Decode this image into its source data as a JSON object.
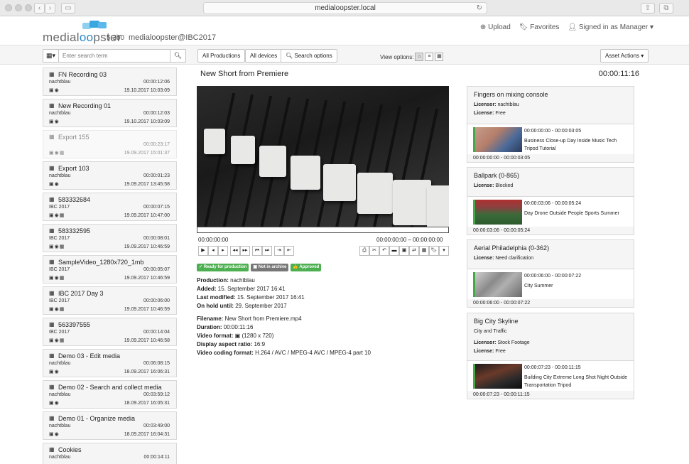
{
  "browser": {
    "url": "medialoopster.local"
  },
  "header": {
    "logo_prefix": "medial",
    "logo_oo": "oo",
    "logo_suffix": "pster",
    "version": "5.3b0",
    "user_context": "medialoopster@IBC2017",
    "upload": "Upload",
    "favorites": "Favorites",
    "signed_in": "Signed in as Manager"
  },
  "toolbar": {
    "search_placeholder": "Enter search term",
    "all_productions": "All Productions",
    "all_devices": "All devices",
    "search_options": "Search options",
    "view_options": "View options:",
    "asset_actions": "Asset Actions"
  },
  "assets": [
    {
      "title": "FN Recording 03",
      "sub": "nachtblau",
      "duration": "00:00:12:06",
      "date": "19.10.2017 10:03:09",
      "icons": "▣◉",
      "dim": false
    },
    {
      "title": "New Recording 01",
      "sub": "nachtblau",
      "duration": "00:00:12:03",
      "date": "19.10.2017 10:03:09",
      "icons": "▣◉",
      "dim": false
    },
    {
      "title": "Export 155",
      "sub": "",
      "duration": "00:00:23:17",
      "date": "19.09.2017 15:01:37",
      "icons": "▣◉▦",
      "dim": true
    },
    {
      "title": "Export 103",
      "sub": "nachtblau",
      "duration": "00:00:01:23",
      "date": "19.09.2017 13:45:58",
      "icons": "▣◉",
      "dim": false
    },
    {
      "title": "583332684",
      "sub": "IBC 2017",
      "duration": "00:00:07:15",
      "date": "19.09.2017 10:47:00",
      "icons": "▣◉▦",
      "dim": false
    },
    {
      "title": "583332595",
      "sub": "IBC 2017",
      "duration": "00:00:08:01",
      "date": "19.09.2017 10:46:59",
      "icons": "▣◉▦",
      "dim": false
    },
    {
      "title": "SampleVideo_1280x720_1mb",
      "sub": "IBC 2017",
      "duration": "00:00:05:07",
      "date": "19.09.2017 10:46:59",
      "icons": "▣◉▦",
      "dim": false
    },
    {
      "title": "IBC 2017 Day 3",
      "sub": "IBC 2017",
      "duration": "00:00:06:00",
      "date": "19.09.2017 10:46:59",
      "icons": "▣◉▦",
      "dim": false
    },
    {
      "title": "563397555",
      "sub": "IBC 2017",
      "duration": "00:00:14:04",
      "date": "19.09.2017 10:46:58",
      "icons": "▣◉▦",
      "dim": false
    },
    {
      "title": "Demo 03 - Edit media",
      "sub": "nachtblau",
      "duration": "00:06:08:15",
      "date": "18.09.2017 16:06:31",
      "icons": "▣◉",
      "dim": false
    },
    {
      "title": "Demo 02 - Search and collect media",
      "sub": "nachtblau",
      "duration": "00:03:59:12",
      "date": "18.09.2017 16:05:31",
      "icons": "▣◉",
      "dim": false
    },
    {
      "title": "Demo 01 - Organize media",
      "sub": "nachtblau",
      "duration": "00:03:49:00",
      "date": "18.09.2017 16:04:31",
      "icons": "▣◉",
      "dim": false
    },
    {
      "title": "Cookies",
      "sub": "nachtblau",
      "duration": "00:00:14:11",
      "date": "",
      "icons": "",
      "dim": false
    }
  ],
  "detail": {
    "title": "New Short from Premiere",
    "timecode": "00:00:11:16",
    "tc_current": "00:00:00:00",
    "tc_range": "00:00:00:00 – 00:00:00:00",
    "badges": [
      {
        "label": "Ready for production",
        "color": "#4caf50",
        "icon": "✓"
      },
      {
        "label": "Not in archive",
        "color": "#777777",
        "icon": "▣"
      },
      {
        "label": "Approved",
        "color": "#4caf50",
        "icon": "👍"
      }
    ],
    "meta1": [
      {
        "k": "Production:",
        "v": "nachtblau"
      },
      {
        "k": "Added:",
        "v": "15. September 2017 16:41"
      },
      {
        "k": "Last modified:",
        "v": "15. September 2017 16:41"
      },
      {
        "k": "On hold until:",
        "v": "29. September 2017"
      }
    ],
    "meta2": [
      {
        "k": "Filename:",
        "v": "New Short from Premiere.mp4"
      },
      {
        "k": "Duration:",
        "v": "00:00:11:16"
      },
      {
        "k": "Video format:",
        "v": "▣ (1280 x 720)"
      },
      {
        "k": "Display aspect ratio:",
        "v": "16:9"
      },
      {
        "k": "Video coding format:",
        "v": "H.264 / AVC / MPEG-4 AVC / MPEG-4 part 10"
      }
    ]
  },
  "related": [
    {
      "title": "Fingers on mixing console",
      "lines": [
        {
          "k": "Licensor:",
          "v": "nachtblau"
        },
        {
          "k": "License:",
          "v": "Free"
        }
      ],
      "tc": "00:00:00:00 - 00:00:03:05",
      "desc": "Business Close-up Day Inside Music Tech Tripod Tutorial",
      "foot": "00:00:00:00 - 00:00:03:05",
      "thumb": "mixing"
    },
    {
      "title": "Ballpark (0-865)",
      "lines": [
        {
          "k": "License:",
          "v": "Blocked"
        }
      ],
      "tc": "00:00:03:06 - 00:00:05:24",
      "desc": "Day Drone Outside People Sports Summer",
      "foot": "00:00:03:06 - 00:00:05:24",
      "thumb": "stadium"
    },
    {
      "title": "Aerial Philadelphia (0-362)",
      "lines": [
        {
          "k": "License:",
          "v": "Need clarification"
        }
      ],
      "tc": "00:00:06:00 - 00:00:07:22",
      "desc": "City Summer",
      "foot": "00:00:06:00 - 00:00:07:22",
      "thumb": "city"
    },
    {
      "title": "Big City Skyline",
      "subtitle": "City and Traffic",
      "lines": [
        {
          "k": "Licensor:",
          "v": "Stock Footage"
        },
        {
          "k": "License:",
          "v": "Free"
        }
      ],
      "tc": "00:00:07:23 - 00:00:11:15",
      "desc": "Building City Extreme Long Shot Night Outside Transportation Tripod",
      "foot": "00:00:07:23 - 00:00:11:15",
      "thumb": "night"
    }
  ]
}
